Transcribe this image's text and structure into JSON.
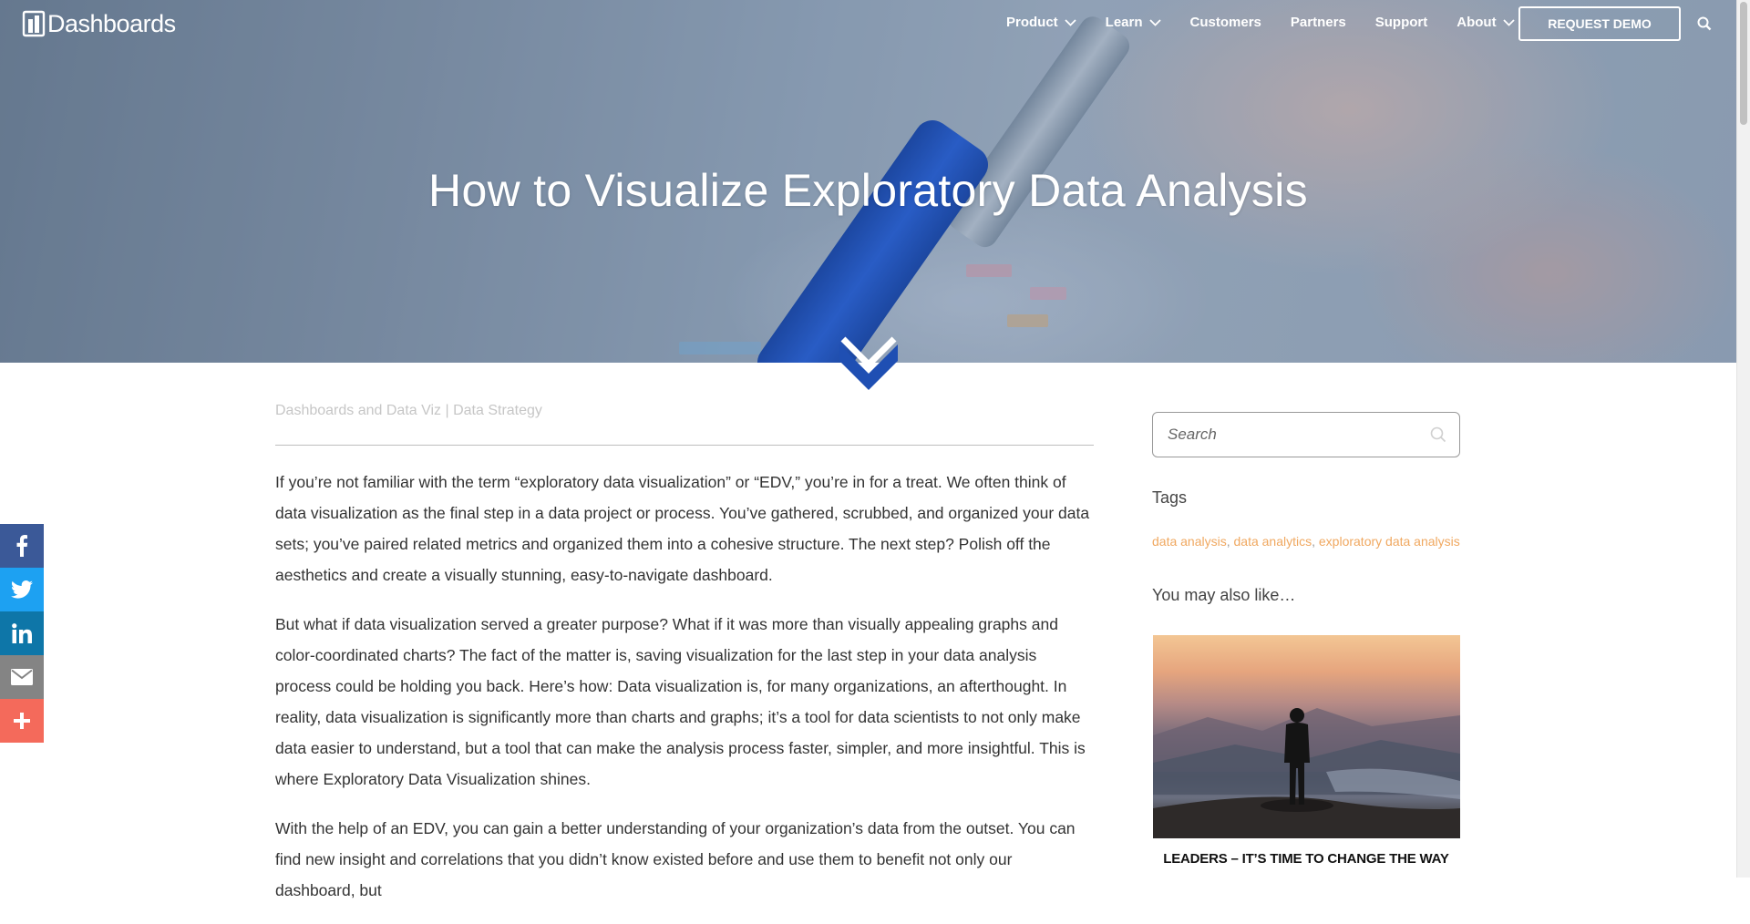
{
  "nav": {
    "logo_text": "Dashboards",
    "items": [
      {
        "label": "Product",
        "dropdown": true
      },
      {
        "label": "Learn",
        "dropdown": true
      },
      {
        "label": "Customers",
        "dropdown": false
      },
      {
        "label": "Partners",
        "dropdown": false
      },
      {
        "label": "Support",
        "dropdown": false
      },
      {
        "label": "About",
        "dropdown": true
      }
    ],
    "demo_button": "REQUEST DEMO"
  },
  "hero": {
    "title": "How to Visualize Exploratory Data Analysis"
  },
  "article": {
    "category_1": "Dashboards and Data Viz",
    "category_sep": " | ",
    "category_2": "Data Strategy",
    "paragraphs": [
      "If you’re not familiar with the term “exploratory data visualization” or “EDV,” you’re in for a treat. We often think of data visualization as the final step in a data project or process. You’ve gathered, scrubbed, and organized your data sets; you’ve paired related metrics and organized them into a cohesive structure. The next step? Polish off the aesthetics and create a visually stunning, easy-to-navigate dashboard.",
      "But what if data visualization served a greater purpose? What if it was more than visually appealing graphs and color-coordinated charts? The fact of the matter is, saving visualization for the last step in your data analysis process could be holding you back. Here’s how: Data visualization is, for many organizations, an afterthought. In reality, data visualization is significantly more than charts and graphs; it’s a tool for data scientists to not only make data easier to understand, but a tool that can make the analysis process faster, simpler, and more insightful. This is where Exploratory Data Visualization shines.",
      "With the help of an EDV, you can gain a better understanding of your organization’s data from the outset. You can find new insight and correlations that you didn’t know existed before and use them to benefit not only our dashboard, but"
    ]
  },
  "sidebar": {
    "search_placeholder": "Search",
    "tags_heading": "Tags",
    "tags": [
      "data analysis",
      "data analytics",
      "exploratory data analysis"
    ],
    "tag_sep": ", ",
    "related_heading": "You may also like…",
    "related_title": "LEADERS – IT’S TIME TO CHANGE THE WAY"
  },
  "social": [
    {
      "name": "facebook",
      "color": "#3b5998"
    },
    {
      "name": "twitter",
      "color": "#1da1f2"
    },
    {
      "name": "linkedin",
      "color": "#0e76a8"
    },
    {
      "name": "email",
      "color": "#848484"
    },
    {
      "name": "more",
      "color": "#f46a5b"
    }
  ],
  "colors": {
    "accent_tag": "#f0a860",
    "hero_chevron": "#1f4fb3"
  }
}
